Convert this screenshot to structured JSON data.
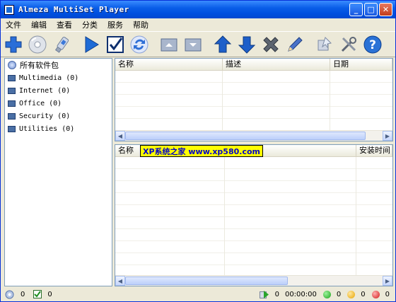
{
  "window": {
    "title": "Almeza MultiSet Player"
  },
  "menu": [
    "文件",
    "编辑",
    "查看",
    "分类",
    "服务",
    "帮助"
  ],
  "toolbar_icons": [
    "add-icon",
    "disc-icon",
    "usb-drive-icon",
    "play-icon",
    "checkmark-icon",
    "refresh-icon",
    "folder-up-icon",
    "folder-down-icon",
    "move-up-icon",
    "move-down-icon",
    "delete-icon",
    "edit-pencil-icon",
    "install-icon",
    "tools-icon",
    "help-icon"
  ],
  "tree": {
    "root": "所有软件包",
    "items": [
      {
        "label": "Multimedia (0)"
      },
      {
        "label": "Internet (0)"
      },
      {
        "label": "Office (0)"
      },
      {
        "label": "Security (0)"
      },
      {
        "label": "Utilities (0)"
      }
    ]
  },
  "top_table": {
    "columns": [
      "名称",
      "描述",
      "日期"
    ]
  },
  "bottom_table": {
    "columns": [
      "名称",
      "安装时间"
    ]
  },
  "watermark": "XP系统之家 www.xp580.com",
  "status": {
    "count_a": "0",
    "count_b": "0",
    "play_count": "0",
    "time": "00:00:00",
    "green_count": "0",
    "yellow_count": "0",
    "red_count": "0"
  },
  "colors": {
    "titlebar": "#0a5ee8",
    "panel_border": "#7f9db9",
    "watermark_bg": "#ffff00",
    "watermark_text": "#0000cc"
  }
}
